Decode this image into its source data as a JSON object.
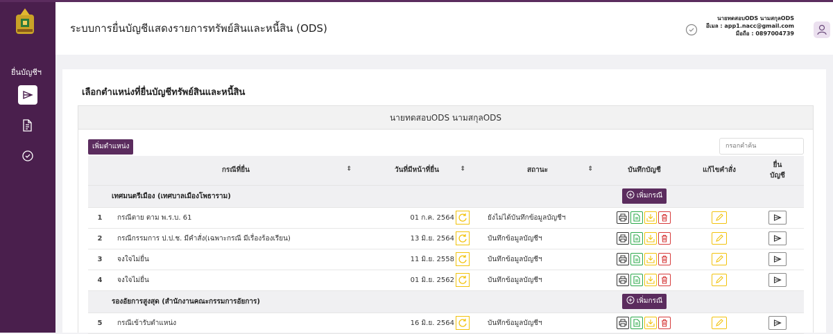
{
  "header": {
    "system_title": "ระบบการยื่นบัญชีแสดงรายการทรัพย์สินและหนี้สิน (ODS)",
    "user_name": "นายทดสอบODS นามสกุลODS",
    "user_email": "อีเมล : app1.nacc@gmail.com",
    "user_phone": "มือถือ : 0897004739"
  },
  "sidebar": {
    "nav_label": "ยื่นบัญชีฯ"
  },
  "main": {
    "page_title": "เลือกตำแหน่งที่ยื่นบัญชีทรัพย์สินและหนี้สิน",
    "panel_title": "นายทดสอบODS นามสกุลODS",
    "add_position_label": "เพิ่มตำแหน่ง",
    "search_placeholder": "กรอกคำค้น",
    "columns": {
      "case": "กรณีที่ยื่น",
      "due_date": "วันที่มีหน้าที่ยื่น",
      "status": "สถานะ",
      "record": "บันทึกบัญชี",
      "edit_order": "แก้ไขคำสั่ง",
      "submit_line1": "ยื่น",
      "submit_line2": "บัญชี"
    },
    "add_case_label": "เพิ่มกรณี",
    "groups": [
      {
        "name": "เทศมนตรีเมือง (เทศบาลเมืองโพธาราม)",
        "rows": [
          {
            "no": "1",
            "case": "กรณีตาย ตาม พ.ร.บ. 61",
            "date": "01 ก.ค. 2564",
            "status": "ยังไม่ได้บันทึกข้อมูลบัญชีฯ"
          },
          {
            "no": "2",
            "case": "กรณีกรรมการ ป.ป.ช. มีคำสั่ง(เฉพาะกรณี มีเรื่องร้องเรียน)",
            "date": "13 มิ.ย. 2564",
            "status": "บันทึกข้อมูลบัญชีฯ"
          },
          {
            "no": "3",
            "case": "จงใจไม่ยื่น",
            "date": "11 มิ.ย. 2558",
            "status": "บันทึกข้อมูลบัญชีฯ"
          },
          {
            "no": "4",
            "case": "จงใจไม่ยื่น",
            "date": "01 มิ.ย. 2562",
            "status": "บันทึกข้อมูลบัญชีฯ"
          }
        ]
      },
      {
        "name": "รองอัยการสูงสุด (สำนักงานคณะกรรมการอัยการ)",
        "rows": [
          {
            "no": "5",
            "case": "กรณีเข้ารับตำแหน่ง",
            "date": "16 มิ.ย. 2564",
            "status": "บันทึกข้อมูลบัญชีฯ"
          }
        ]
      }
    ]
  },
  "colors": {
    "brand": "#4a1f4d",
    "button": "#5b2c5e",
    "refresh": "#f2c20b",
    "doc": "#2ba84a",
    "trash": "#d63b3b"
  }
}
